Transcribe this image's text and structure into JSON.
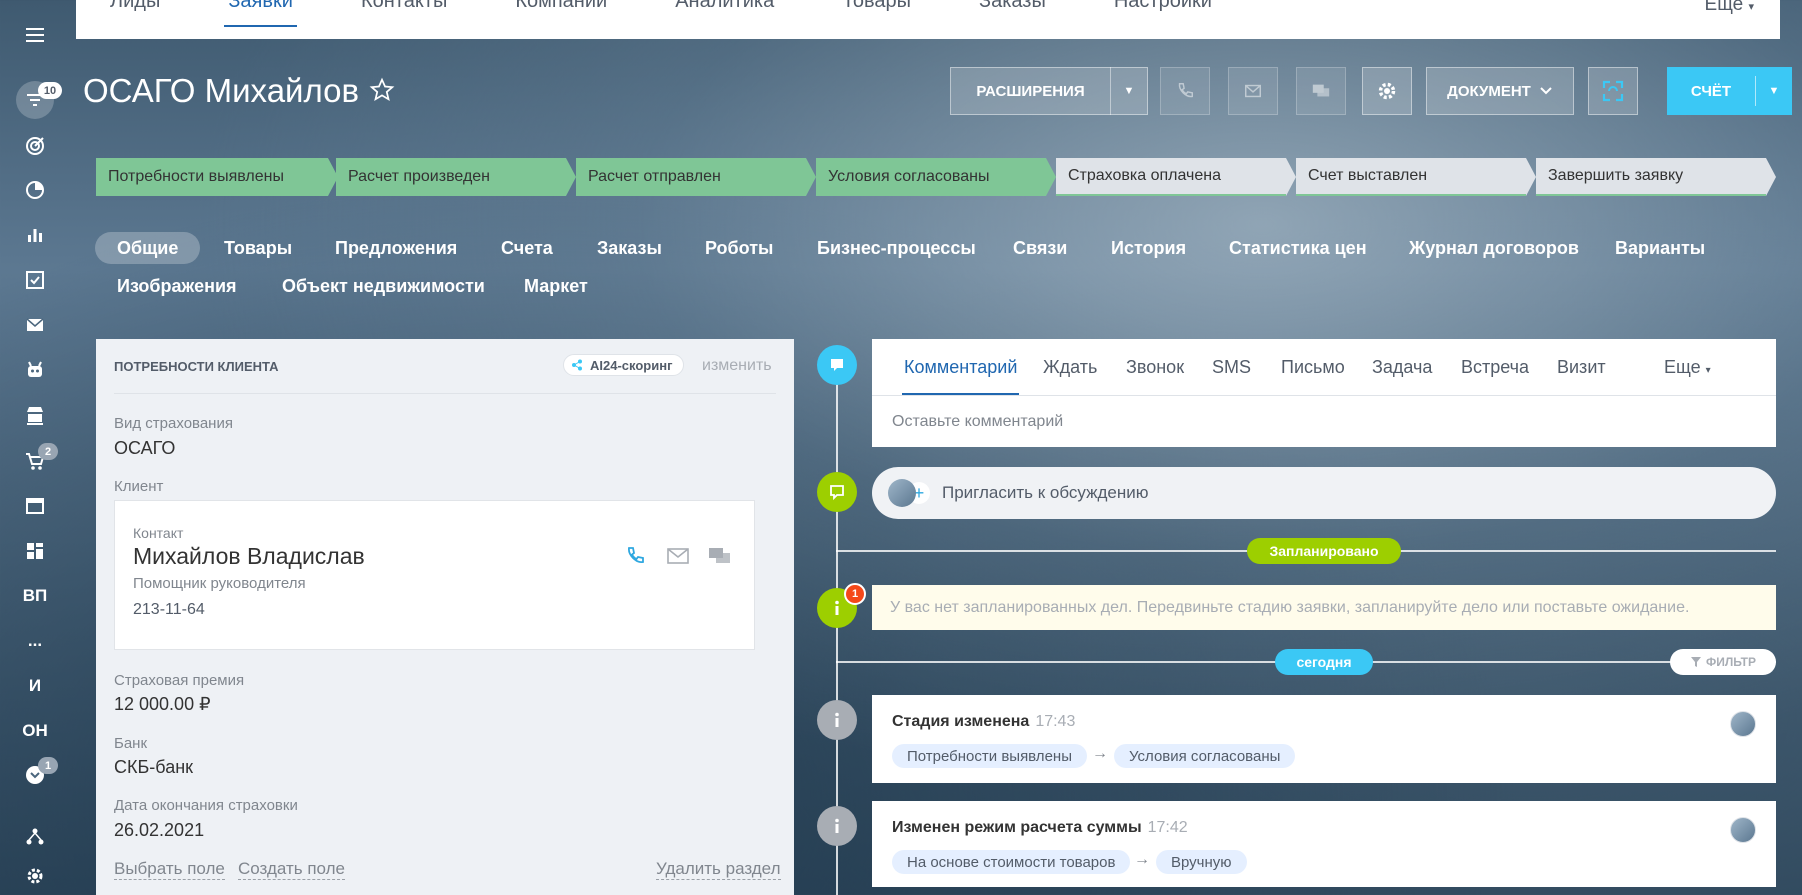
{
  "rail": {
    "badges": {
      "filter": "10",
      "cart": "2",
      "chevron": "1"
    },
    "texts": {
      "vp": "ВП",
      "dots": "...",
      "i": "И",
      "on": "ОН"
    }
  },
  "topnav": {
    "items": [
      "Лиды",
      "Заявки",
      "Контакты",
      "Компании",
      "Аналитика",
      "Товары",
      "Заказы",
      "Настройки"
    ],
    "active_index": 1,
    "more": "Еще"
  },
  "header": {
    "title": "ОСАГО Михайлов",
    "extensions_label": "РАСШИРЕНИЯ",
    "document_label": "ДОКУМЕНТ",
    "invoice_label": "СЧЁТ"
  },
  "stages": [
    {
      "label": "Потребности выявлены",
      "done": true
    },
    {
      "label": "Расчет произведен",
      "done": true
    },
    {
      "label": "Расчет отправлен",
      "done": true
    },
    {
      "label": "Условия согласованы",
      "done": true
    },
    {
      "label": "Страховка оплачена",
      "done": false
    },
    {
      "label": "Счет выставлен",
      "done": false
    },
    {
      "label": "Завершить заявку",
      "done": false
    }
  ],
  "tabs": {
    "row1": [
      "Общие",
      "Товары",
      "Предложения",
      "Счета",
      "Заказы",
      "Роботы",
      "Бизнес-процессы",
      "Связи",
      "История",
      "Статистика цен",
      "Журнал договоров",
      "Варианты"
    ],
    "row2": [
      "Изображения",
      "Объект недвижимости",
      "Маркет"
    ],
    "active": "Общие"
  },
  "card": {
    "title": "ПОТРЕБНОСТИ КЛИЕНТА",
    "ai_badge": "AI24-скоринг",
    "edit": "изменить",
    "insurance_type_label": "Вид страхования",
    "insurance_type_value": "ОСАГО",
    "client_label": "Клиент",
    "contact": {
      "label": "Контакт",
      "name": "Михайлов Владислав",
      "position": "Помощник руководителя",
      "phone": "213-11-64"
    },
    "premium_label": "Страховая премия",
    "premium_value": "12 000.00 ₽",
    "bank_label": "Банк",
    "bank_value": "СКБ-банк",
    "end_date_label": "Дата окончания страховки",
    "end_date_value": "26.02.2021",
    "select_field": "Выбрать поле",
    "create_field": "Создать поле",
    "delete_section": "Удалить раздел"
  },
  "composer": {
    "tabs": [
      "Комментарий",
      "Ждать",
      "Звонок",
      "SMS",
      "Письмо",
      "Задача",
      "Встреча",
      "Визит"
    ],
    "more": "Еще",
    "placeholder": "Оставьте комментарий"
  },
  "invite": {
    "label": "Пригласить к обсуждению"
  },
  "timeline": {
    "planned_pill": "Запланировано",
    "notice_count": "1",
    "notice_text": "У вас нет запланированных дел. Передвиньте стадию заявки, запланируйте дело или поставьте ожидание.",
    "today_pill": "сегодня",
    "filter_label": "ФИЛЬТР",
    "events": [
      {
        "title": "Стадия изменена",
        "time": "17:43",
        "from": "Потребности выявлены",
        "to": "Условия согласованы"
      },
      {
        "title": "Изменен режим расчета суммы",
        "time": "17:42",
        "from": "На основе стоимости товаров",
        "to": "Вручную"
      }
    ]
  },
  "colors": {
    "accent": "#3bc8f5",
    "link_blue": "#2067b0",
    "stage_done": "#7fc696",
    "stage_todo": "#dfe3e8",
    "timeline_green": "#9dcf00",
    "notice_red": "#f54819"
  }
}
